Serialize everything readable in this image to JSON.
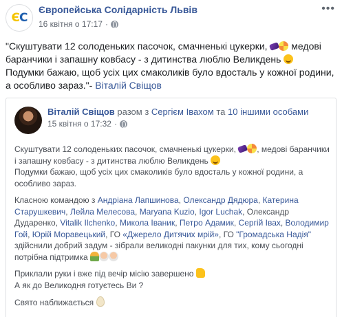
{
  "page": {
    "name": "Європейська Солідарність Львів",
    "logo_letters": {
      "e": "Є",
      "c": "С"
    },
    "timestamp": "16 квітня о 17:17",
    "audience_icon": "globe-icon",
    "more_icon": "more-options-icon"
  },
  "quote": {
    "line1": "\"Скуштувати 12 солоденьких пасочок, смачненькі цукерки,",
    "line2": " медові баранчики і запашну ковбасу - з дитинства люблю Великдень",
    "line3": "Подумки бажаю, щоб усіх цих смаколиків було вдосталь у кожної родини, а особливо зараз.\"-",
    "author": "Віталій Свіщов"
  },
  "shared_post": {
    "author": "Віталій Свіщов",
    "with_prefix": "разом з",
    "with_person": "Сергієм Івахом",
    "and_word": "та",
    "others": "10 іншими особами",
    "timestamp": "15 квітня о 17:32",
    "para1_a": "Скуштувати 12 солоденьких пасочок, смачненькі цукерки,",
    "para1_b": ", медові баранчики і запашну ковбасу - з дитинства люблю Великдень",
    "para2": "Подумки бажаю, щоб усіх цих смаколиків було вдосталь у кожної родини, а особливо зараз.",
    "team_intro": "Класною командою з",
    "mentions": [
      "Андріана Лапшинова",
      "Олександр Дядюра",
      "Катерина Старушкевич",
      "Лейла Мелесова",
      "Maryana Kuzio",
      "Igor Luchak"
    ],
    "plain1": "Олександр Дударенко",
    "mentions2": [
      "Vitalik Ilchenko",
      "Микола Іваник",
      "Петро Адамик",
      "Сергій Іваx",
      "Володимир Гой",
      "Юрій Моравецький"
    ],
    "go1_prefix": "ГО",
    "go1": "«Джерело Дитячих мрій»",
    "go2_prefix": "ГО",
    "go2": "\"Громадська Надія\"",
    "team_outro": "здійснили добрий задум - зібрали великодні пакунки для тих, кому сьогодні потрібна підтримка",
    "para4_a": "Приклали руки і вже під вечір місію завершено",
    "para4_b": "А як до Великодня готуєтесь Ви ?",
    "para5": "Свято наближається"
  },
  "emoji": [
    "candy",
    "lollipop",
    "grinning-face",
    "people",
    "old-woman",
    "old-man",
    "thumbs-up",
    "egg"
  ]
}
